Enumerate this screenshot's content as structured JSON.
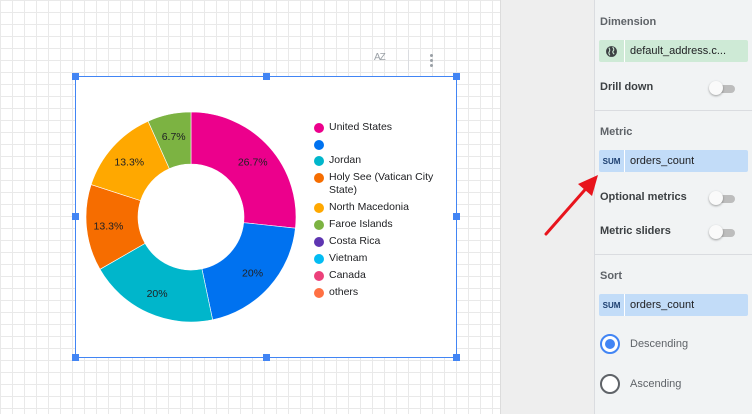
{
  "chart_toolbar": {
    "sort_icon": "AZ",
    "more_icon": "more-vert-icon"
  },
  "chart_data": {
    "type": "pie",
    "donut": true,
    "categories": [
      "United States",
      "",
      "Jordan",
      "Holy See (Vatican City State)",
      "North Macedonia",
      "Faroe Islands",
      "Costa Rica",
      "Vietnam",
      "Canada",
      "others"
    ],
    "values": [
      26.7,
      20,
      20,
      13.3,
      13.3,
      6.7,
      0,
      0,
      0,
      0
    ],
    "slice_labels": [
      "26.7%",
      "20%",
      "20%",
      "13.3%",
      "13.3%",
      "6.7%",
      "",
      "",
      "",
      ""
    ],
    "colors": [
      "#ec008c",
      "#0072f0",
      "#00b6cb",
      "#f66d00",
      "#ffa800",
      "#7cb342",
      "#5e35b1",
      "#03bcf3",
      "#ec407a",
      "#ff7043"
    ],
    "legend_position": "right"
  },
  "panel": {
    "dimension_title": "Dimension",
    "dimension_field": "default_address.c...",
    "drill_down_label": "Drill down",
    "metric_title": "Metric",
    "metric_agg": "SUM",
    "metric_field": "orders_count",
    "optional_metrics_label": "Optional metrics",
    "metric_sliders_label": "Metric sliders",
    "sort_title": "Sort",
    "sort_agg": "SUM",
    "sort_field": "orders_count",
    "descending_label": "Descending",
    "ascending_label": "Ascending",
    "toggle_color": "#bdbdbd",
    "accent": "#4285f4",
    "arrow_color": "#e8141c"
  }
}
